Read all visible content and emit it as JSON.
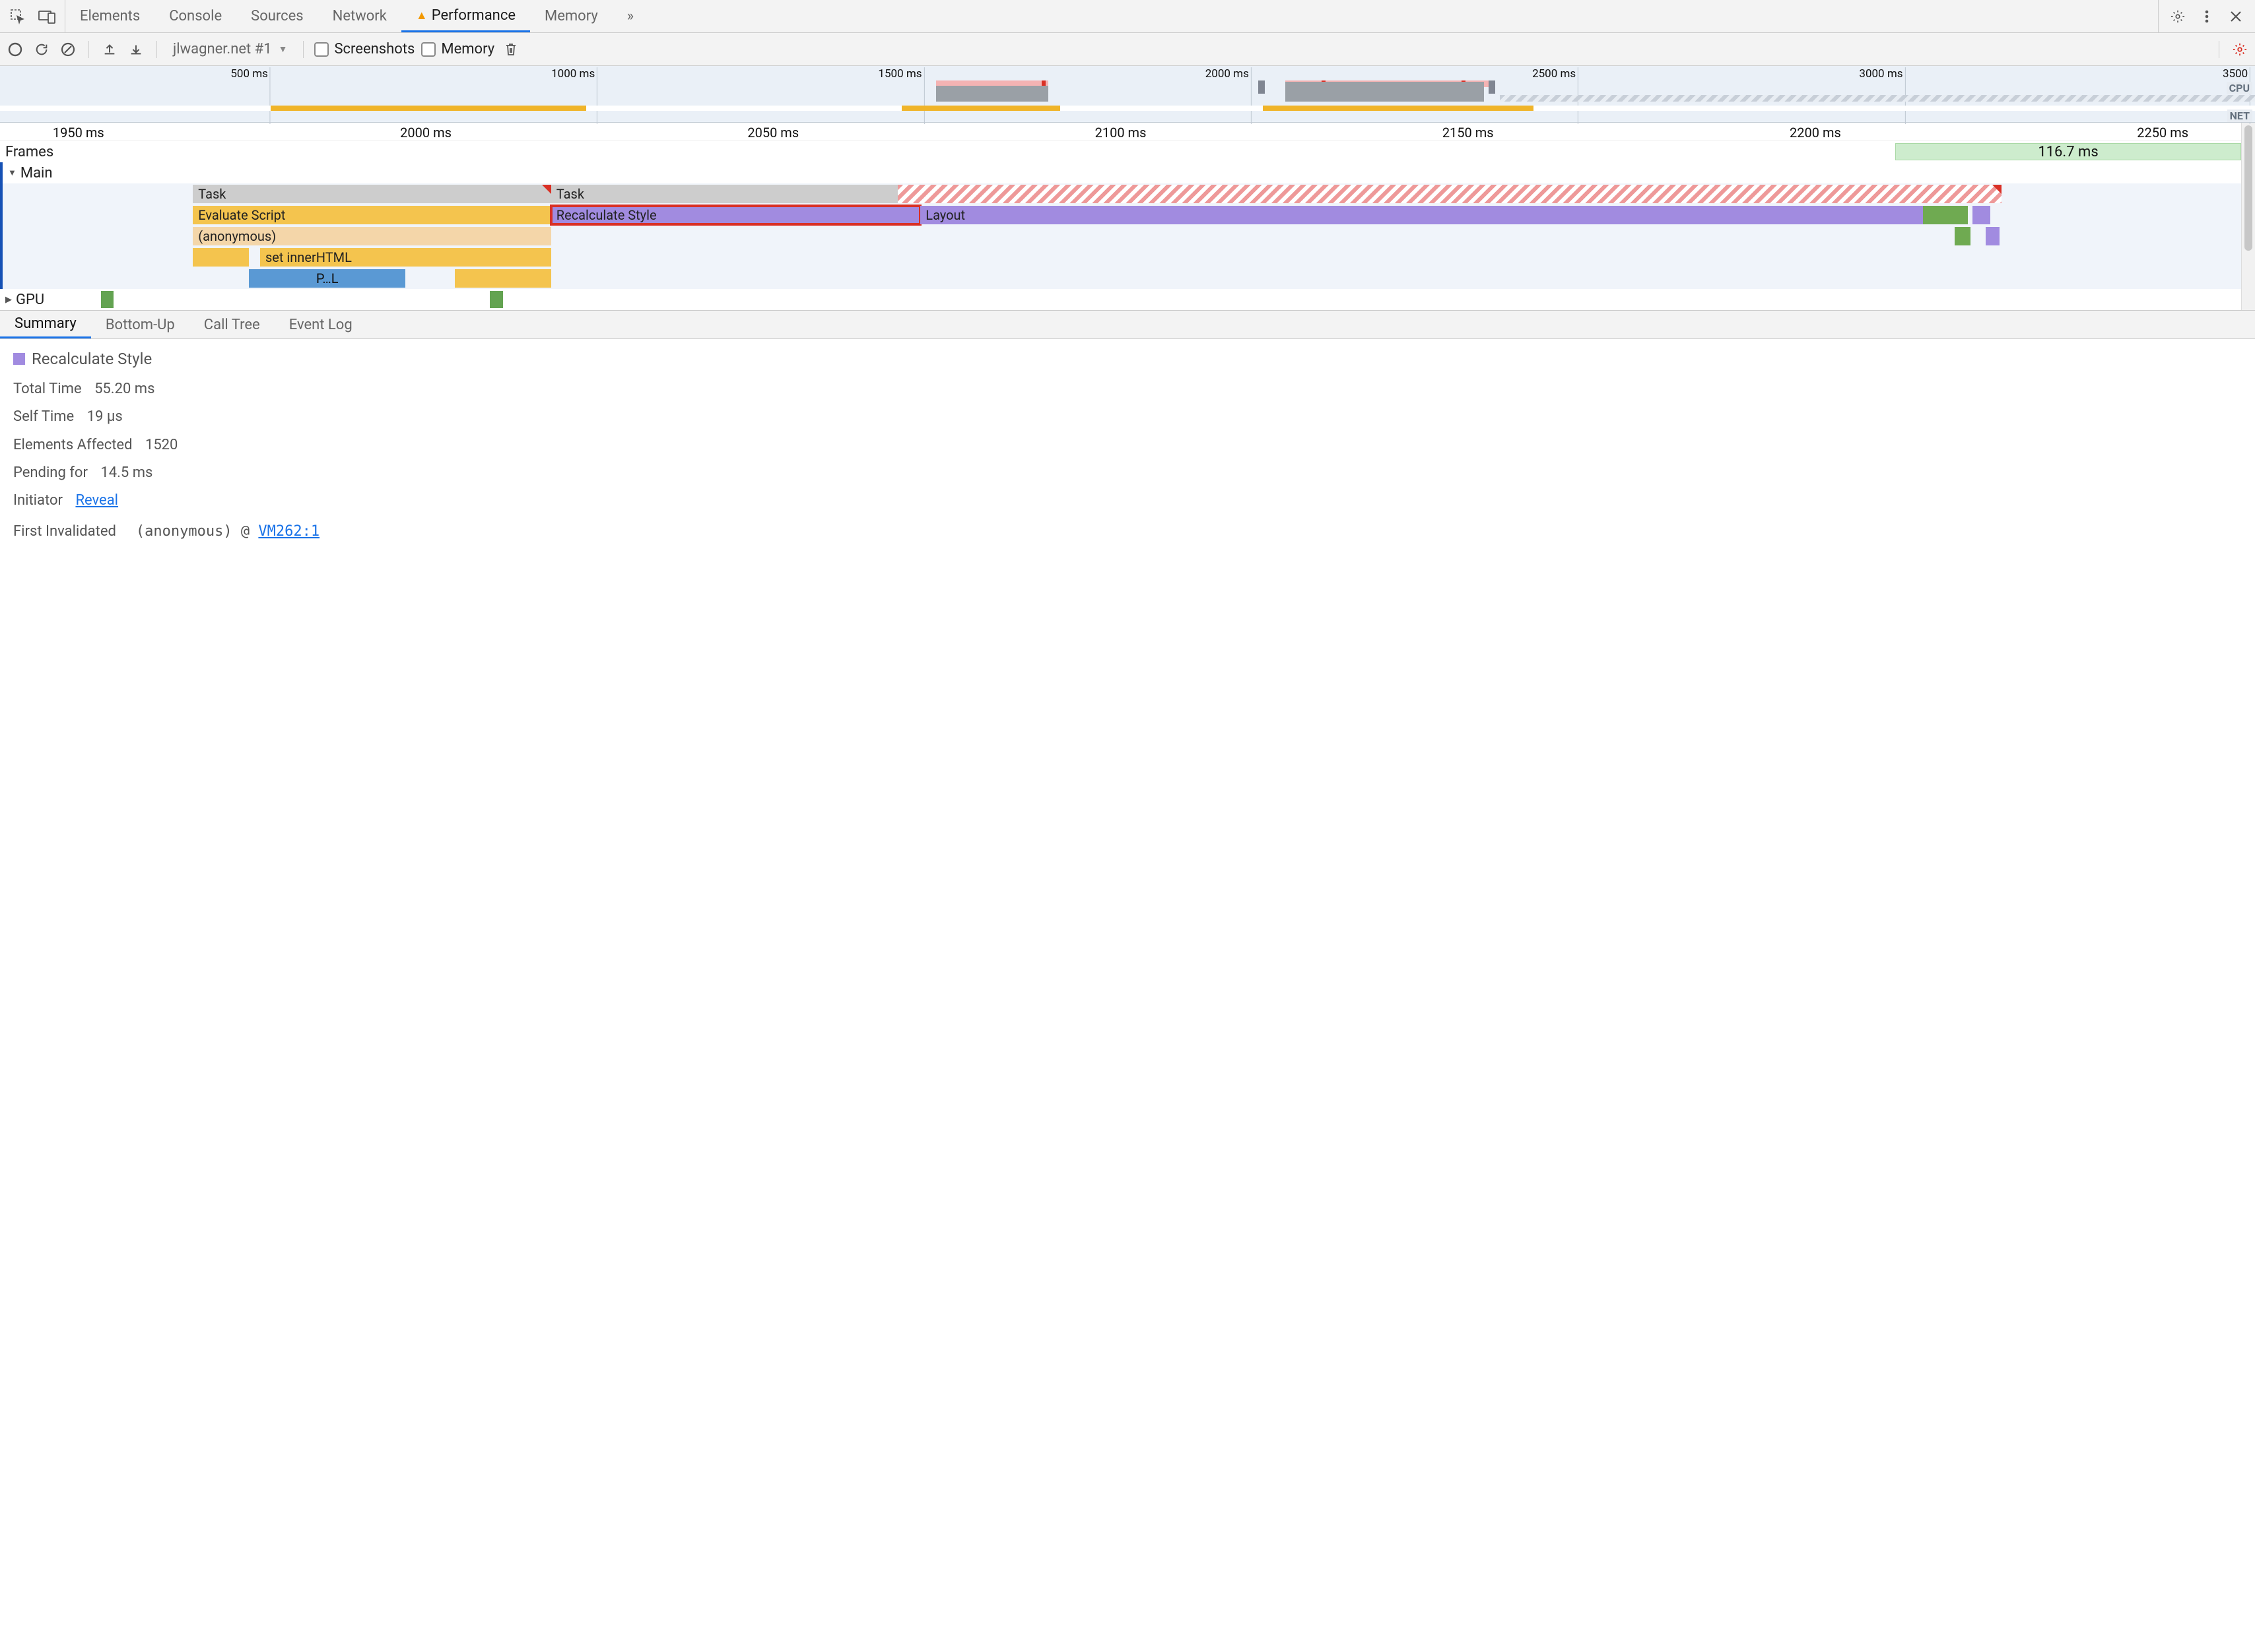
{
  "tabs": {
    "items": [
      "Elements",
      "Console",
      "Sources",
      "Network",
      "Performance",
      "Memory"
    ],
    "active": "Performance",
    "overflow_glyph": "»"
  },
  "toolbar": {
    "target_label": "jlwagner.net #1",
    "screenshots_label": "Screenshots",
    "memory_label": "Memory"
  },
  "overview": {
    "ticks": [
      "500 ms",
      "1000 ms",
      "1500 ms",
      "2000 ms",
      "2500 ms",
      "3000 ms",
      "3500"
    ],
    "cpu_label": "CPU",
    "net_label": "NET"
  },
  "flame": {
    "xaxis": [
      "1950 ms",
      "2000 ms",
      "2050 ms",
      "2100 ms",
      "2150 ms",
      "2200 ms",
      "2250 ms"
    ],
    "frames_label": "Frames",
    "frame_pill": "116.7 ms",
    "main_label": "Main",
    "gpu_label": "GPU",
    "bars": {
      "task1": "Task",
      "task2": "Task",
      "eval_script": "Evaluate Script",
      "recalc": "Recalculate Style",
      "layout": "Layout",
      "anon": "(anonymous)",
      "set_inner": "set innerHTML",
      "pl": "P…L"
    }
  },
  "bottom_tabs": {
    "items": [
      "Summary",
      "Bottom-Up",
      "Call Tree",
      "Event Log"
    ],
    "active": "Summary"
  },
  "summary": {
    "event_name": "Recalculate Style",
    "total_time_label": "Total Time",
    "total_time_value": "55.20 ms",
    "self_time_label": "Self Time",
    "self_time_value": "19 µs",
    "elements_affected_label": "Elements Affected",
    "elements_affected_value": "1520",
    "pending_for_label": "Pending for",
    "pending_for_value": "14.5 ms",
    "initiator_label": "Initiator",
    "initiator_link": "Reveal",
    "first_invalidated_label": "First Invalidated",
    "first_invalidated_fn": "(anonymous)",
    "first_invalidated_sep": "@",
    "first_invalidated_loc": "VM262:1"
  }
}
